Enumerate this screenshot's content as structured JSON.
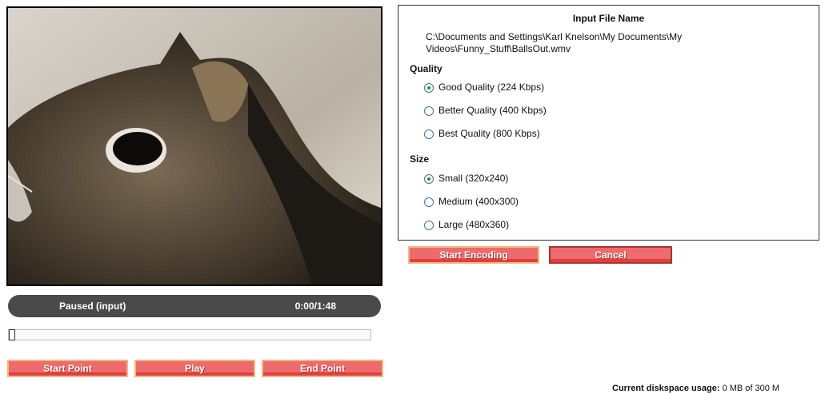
{
  "player": {
    "status": "Paused (input)",
    "time": "0:00/1:48",
    "position_fraction": 0.0
  },
  "controls": {
    "start_point": "Start Point",
    "play": "Play",
    "end_point": "End Point"
  },
  "panel": {
    "title": "Input File Name",
    "file_path": "C:\\Documents and Settings\\Karl Knelson\\My Documents\\My Videos\\Funny_Stuff\\BallsOut.wmv",
    "quality_label": "Quality",
    "quality_options": [
      {
        "label": "Good Quality (224 Kbps)",
        "selected": true
      },
      {
        "label": "Better Quality (400 Kbps)",
        "selected": false
      },
      {
        "label": "Best Quality (800 Kbps)",
        "selected": false
      }
    ],
    "size_label": "Size",
    "size_options": [
      {
        "label": "Small (320x240)",
        "selected": true
      },
      {
        "label": "Medium (400x300)",
        "selected": false
      },
      {
        "label": "Large (480x360)",
        "selected": false
      }
    ]
  },
  "actions": {
    "start_encoding": "Start Encoding",
    "cancel": "Cancel"
  },
  "footer": {
    "disk_label": "Current diskspace usage:",
    "disk_value": "0 MB of 300 M"
  },
  "colors": {
    "button_fill": "#ee6b6b",
    "status_bar": "#4a4a4a"
  }
}
